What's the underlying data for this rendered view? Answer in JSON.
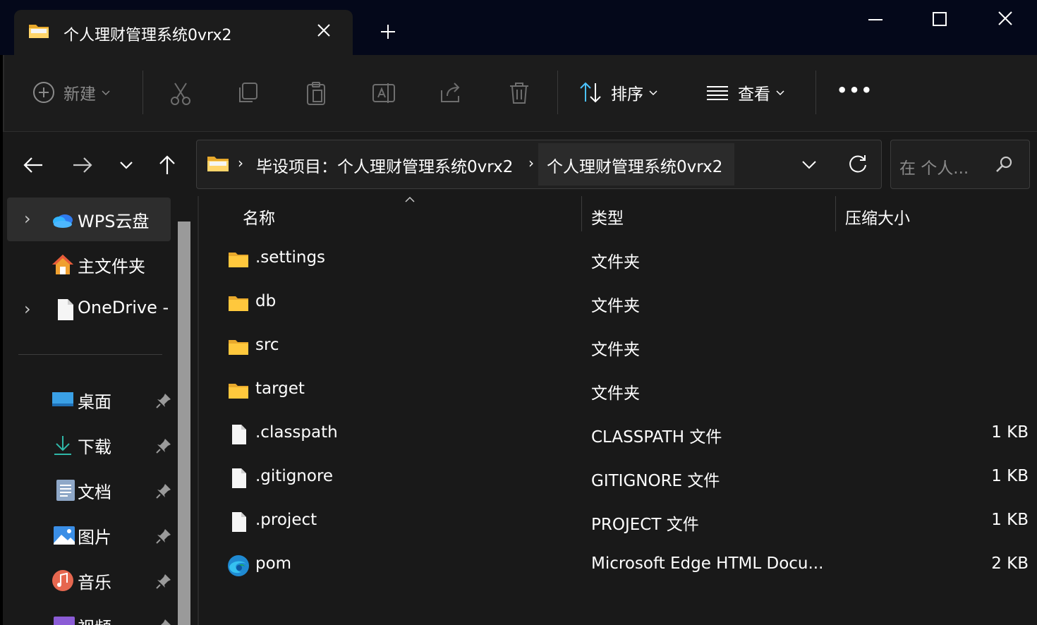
{
  "window": {
    "tab_title": "个人理财管理系统0vrx2",
    "new_tab_symbol": "+"
  },
  "toolbar": {
    "new_label": "新建",
    "sort_label": "排序",
    "view_label": "查看",
    "more_label": "•••"
  },
  "address": {
    "crumbs": [
      "毕设项目：个人理财管理系统0vrx2",
      "个人理财管理系统0vrx2"
    ],
    "separator": "›"
  },
  "search": {
    "placeholder": "在 个人..."
  },
  "sidebar": {
    "items": [
      {
        "label": "WPS云盘"
      },
      {
        "label": "主文件夹"
      },
      {
        "label": "OneDrive -"
      },
      {
        "label": "桌面"
      },
      {
        "label": "下载"
      },
      {
        "label": "文档"
      },
      {
        "label": "图片"
      },
      {
        "label": "音乐"
      },
      {
        "label": "视频"
      }
    ],
    "expand_symbol": "›"
  },
  "columns": {
    "name": "名称",
    "type": "类型",
    "size": "压缩大小"
  },
  "files": [
    {
      "name": ".settings",
      "type": "文件夹",
      "size": "",
      "icon": "folder-icon"
    },
    {
      "name": "db",
      "type": "文件夹",
      "size": "",
      "icon": "folder-icon"
    },
    {
      "name": "src",
      "type": "文件夹",
      "size": "",
      "icon": "folder-icon"
    },
    {
      "name": "target",
      "type": "文件夹",
      "size": "",
      "icon": "folder-icon"
    },
    {
      "name": ".classpath",
      "type": "CLASSPATH 文件",
      "size": "1 KB",
      "icon": "file-icon"
    },
    {
      "name": ".gitignore",
      "type": "GITIGNORE 文件",
      "size": "1 KB",
      "icon": "file-icon"
    },
    {
      "name": ".project",
      "type": "PROJECT 文件",
      "size": "1 KB",
      "icon": "file-icon"
    },
    {
      "name": "pom",
      "type": "Microsoft Edge HTML Docu...",
      "size": "2 KB",
      "icon": "edge-icon"
    }
  ],
  "colors": {
    "background": "#191919",
    "titlebar": "#04081a",
    "folder_yellow": "#ffc83d"
  }
}
